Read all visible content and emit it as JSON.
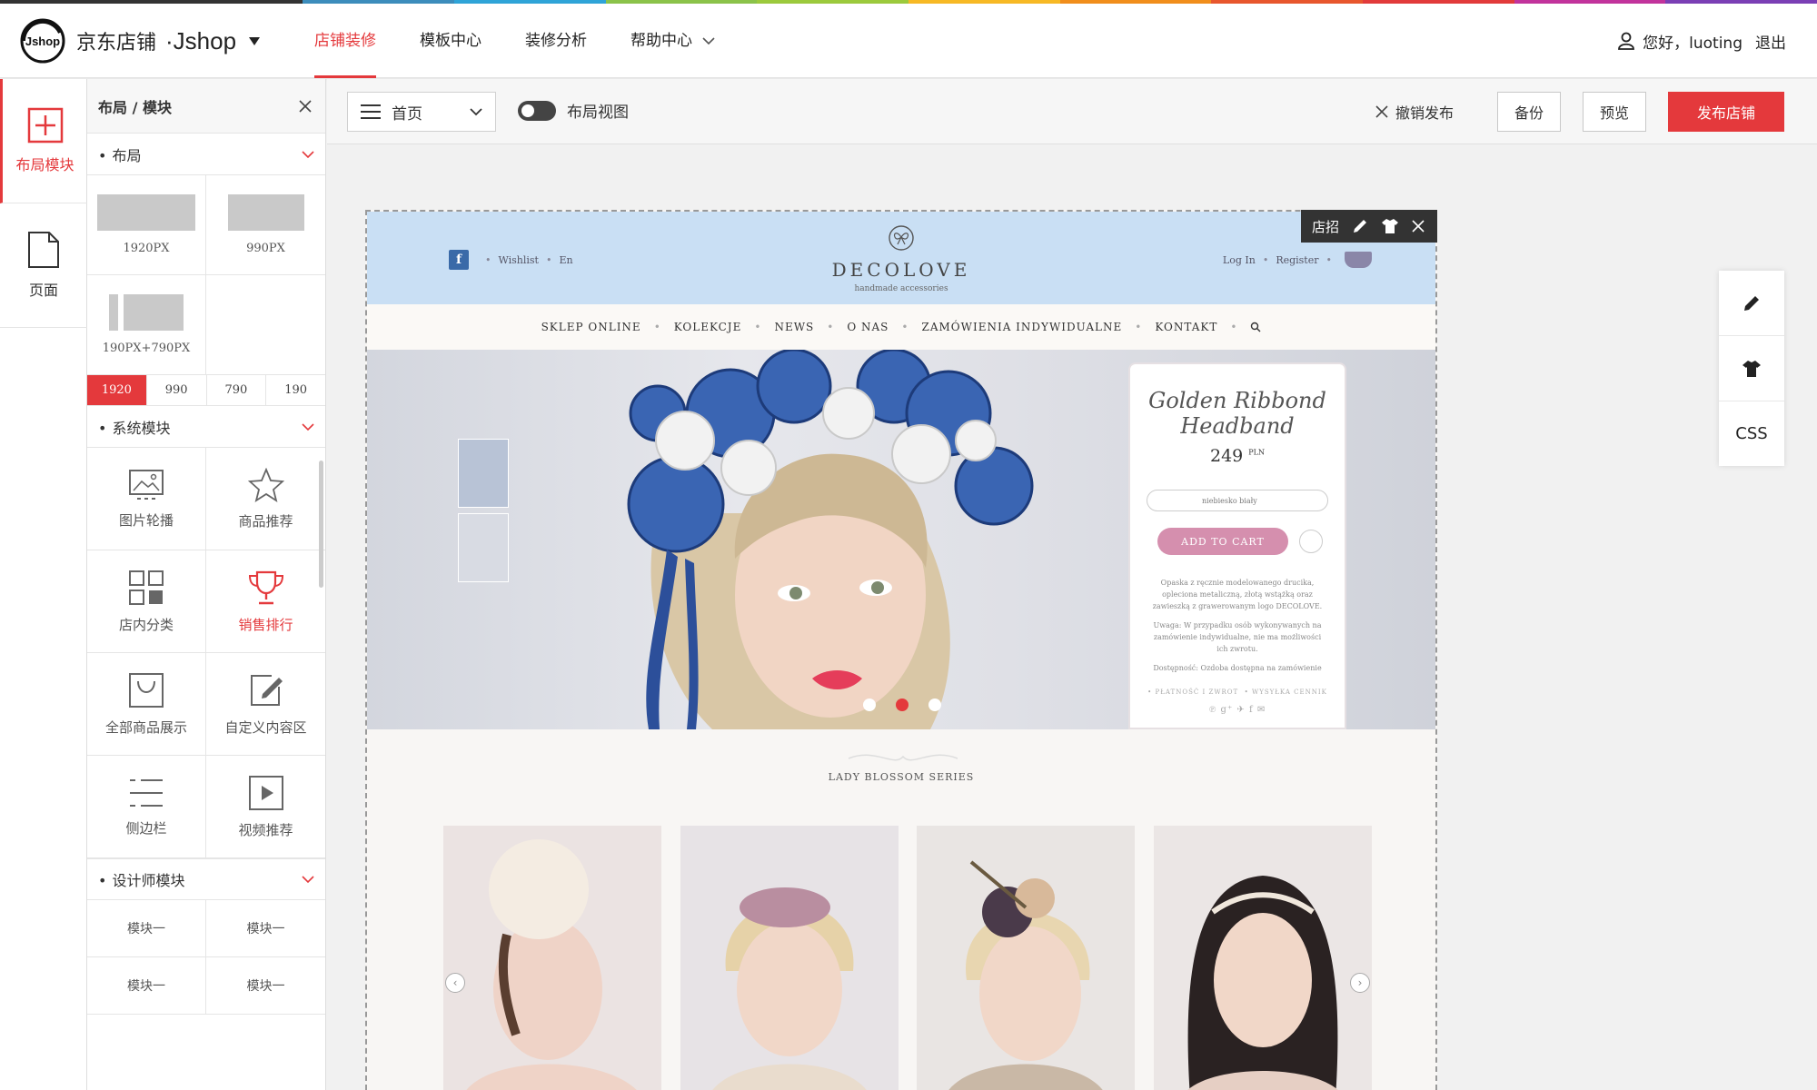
{
  "colors": {
    "accent": "#e4393c",
    "rainbow": [
      "#333333",
      "#333333",
      "#3c8dbc",
      "#2fa4d8",
      "#8bc34a",
      "#9cca3c",
      "#f7b924",
      "#f18e1c",
      "#e8572e",
      "#e23b3b",
      "#c2339c",
      "#7b3fb5"
    ]
  },
  "brand": {
    "logo_text": "Jshop",
    "name": "京东店铺",
    "sub": "·Jshop"
  },
  "nav": [
    {
      "label": "店铺装修",
      "active": true
    },
    {
      "label": "模板中心"
    },
    {
      "label": "装修分析"
    },
    {
      "label": "帮助中心",
      "dropdown": true
    }
  ],
  "user": {
    "greeting": "您好，luoting",
    "logout": "退出"
  },
  "rail": [
    {
      "label": "布局模块",
      "icon": "plus-square-icon",
      "active": true
    },
    {
      "label": "页面",
      "icon": "page-icon"
    }
  ],
  "panel": {
    "title": "布局 / 模块",
    "layout_section": "布局",
    "layouts": [
      {
        "label": "1920PX"
      },
      {
        "label": "990PX"
      },
      {
        "label": "190PX+790PX"
      }
    ],
    "widths": [
      {
        "label": "1920",
        "active": true
      },
      {
        "label": "990"
      },
      {
        "label": "790"
      },
      {
        "label": "190"
      }
    ],
    "system_section": "系统模块",
    "system_modules": [
      {
        "label": "图片轮播",
        "icon": "image-carousel-icon"
      },
      {
        "label": "商品推荐",
        "icon": "star-icon"
      },
      {
        "label": "店内分类",
        "icon": "category-grid-icon"
      },
      {
        "label": "销售排行",
        "icon": "trophy-icon",
        "active": true
      },
      {
        "label": "全部商品展示",
        "icon": "shopping-bag-icon"
      },
      {
        "label": "自定义内容区",
        "icon": "edit-icon"
      },
      {
        "label": "侧边栏",
        "icon": "sidebar-icon"
      },
      {
        "label": "视频推荐",
        "icon": "video-icon"
      }
    ],
    "designer_section": "设计师模块",
    "designer_modules": [
      {
        "label": "模块一"
      },
      {
        "label": "模块一"
      },
      {
        "label": "模块一"
      },
      {
        "label": "模块一"
      }
    ]
  },
  "toolbar": {
    "page_select": "首页",
    "layout_view": "布局视图",
    "revoke": "撤销发布",
    "backup": "备份",
    "preview": "预览",
    "publish": "发布店铺"
  },
  "sign_tools": {
    "label": "店招"
  },
  "store": {
    "logo_name": "DECOLOVE",
    "logo_sub": "handmade accessories",
    "fb": "f",
    "wishlist": "Wishlist",
    "lang": "En",
    "login": "Log In",
    "register": "Register",
    "menu": [
      "SKLEP ONLINE",
      "KOLEKCJE",
      "NEWS",
      "O NAS",
      "ZAMÓWIENIA INDYWIDUALNE",
      "KONTAKT"
    ],
    "product": {
      "title_line1": "Golden Ribbond",
      "title_line2": "Headband",
      "price": "249",
      "currency": "PLN",
      "variant": "niebiesko biały",
      "cart_button": "ADD TO CART",
      "desc1": "Opaska z ręcznie modelowanego drucika, opleciona metaliczną, złotą wstążką oraz zawieszką z grawerowanym logo DECOLOVE.",
      "desc2": "Uwaga: W przypadku osób wykonywanych na zamówienie indywidualne, nie ma możliwości ich zwrotu.",
      "desc3": "Dostępność: Ozdoba dostępna na zamówienie",
      "meta1": "PŁATNOŚĆ I ZWROT",
      "meta2": "WYSYŁKA CENNIK",
      "social": "℗ g⁺ ✈ f ✉"
    },
    "series": "LADY BLOSSOM SERIES"
  },
  "right_tools": [
    {
      "icon": "pencil-icon"
    },
    {
      "icon": "tshirt-icon"
    },
    {
      "label": "CSS"
    }
  ]
}
